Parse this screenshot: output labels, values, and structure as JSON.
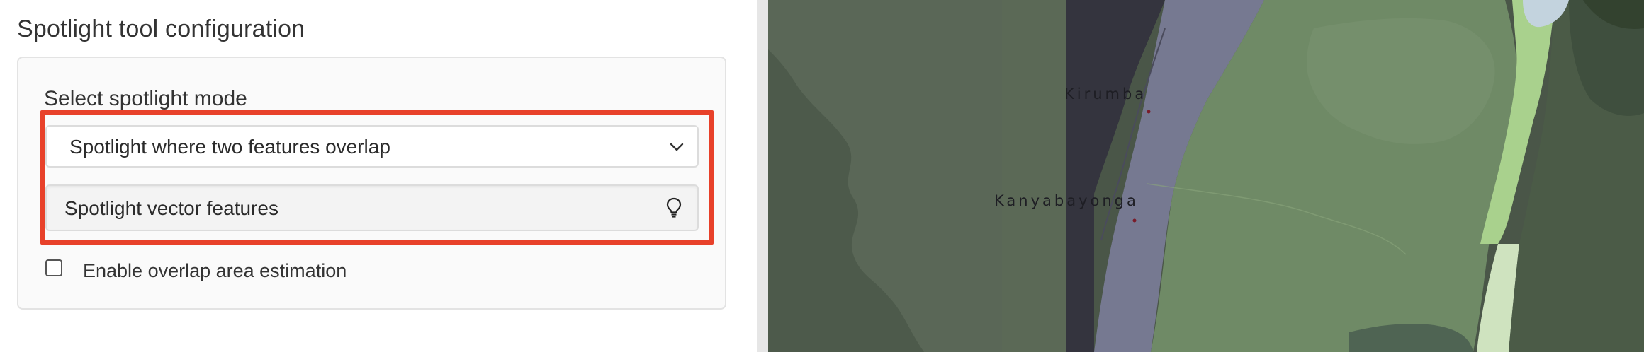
{
  "panel": {
    "title": "Spotlight tool configuration",
    "mode_label": "Select spotlight mode",
    "mode_select": {
      "value": "Spotlight where two features overlap"
    },
    "spotlight_button_label": "Spotlight vector features",
    "overlap_checkbox": {
      "label": "Enable overlap area estimation",
      "checked": false
    }
  },
  "map": {
    "place_labels": [
      "Kirumba",
      "Kanyabayonga"
    ]
  },
  "colors": {
    "highlight_outline": "#e8412a",
    "map_green": "#6f8a66",
    "map_dark_band": "#35353f",
    "map_purple_band": "#777a95",
    "map_light_green": "#a9d18d"
  },
  "icons": {
    "select_chevron": "chevron-down-icon",
    "spotlight_button": "lightbulb-icon"
  }
}
